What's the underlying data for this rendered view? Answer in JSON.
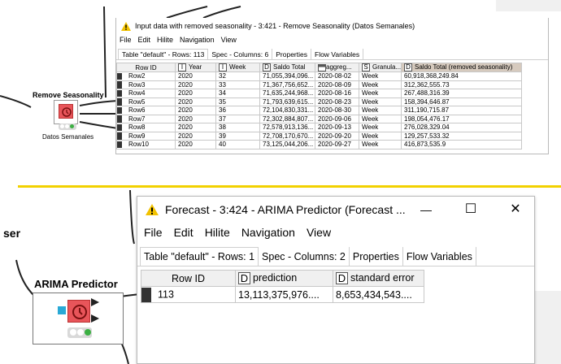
{
  "top": {
    "node": {
      "title": "Remove Seasonality",
      "label": "Datos Semanales"
    },
    "window": {
      "title": "Input data with removed seasonality - 3:421 - Remove Seasonality (Datos Semanales)",
      "menu": [
        "File",
        "Edit",
        "Hilite",
        "Navigation",
        "View"
      ],
      "tabs": [
        "Table \"default\" - Rows: 113",
        "Spec - Columns: 6",
        "Properties",
        "Flow Variables"
      ],
      "columns": [
        {
          "type": "",
          "name": "Row ID"
        },
        {
          "type": "I",
          "name": "Year"
        },
        {
          "type": "I",
          "name": "Week"
        },
        {
          "type": "D",
          "name": "Saldo Total"
        },
        {
          "type": "cal-icon",
          "name": "aggreg..."
        },
        {
          "type": "S",
          "name": "Granula..."
        },
        {
          "type": "D",
          "name": "Saldo Total (removed seasonality)"
        }
      ],
      "rows": [
        [
          "Row2",
          "2020",
          "32",
          "71,055,394,096...",
          "2020-08-02",
          "Week",
          "60,918,368,249.84"
        ],
        [
          "Row3",
          "2020",
          "33",
          "71,367,756,652...",
          "2020-08-09",
          "Week",
          "312,362,555.73"
        ],
        [
          "Row4",
          "2020",
          "34",
          "71,635,244,968...",
          "2020-08-16",
          "Week",
          "267,488,316.39"
        ],
        [
          "Row5",
          "2020",
          "35",
          "71,793,639,615...",
          "2020-08-23",
          "Week",
          "158,394,646.87"
        ],
        [
          "Row6",
          "2020",
          "36",
          "72,104,830,331...",
          "2020-08-30",
          "Week",
          "311,190,715.87"
        ],
        [
          "Row7",
          "2020",
          "37",
          "72,302,884,807...",
          "2020-09-06",
          "Week",
          "198,054,476.17"
        ],
        [
          "Row8",
          "2020",
          "38",
          "72,578,913,136...",
          "2020-09-13",
          "Week",
          "276,028,329.04"
        ],
        [
          "Row9",
          "2020",
          "39",
          "72,708,170,670...",
          "2020-09-20",
          "Week",
          "129,257,533.32"
        ],
        [
          "Row10",
          "2020",
          "40",
          "73,125,044,206...",
          "2020-09-27",
          "Week",
          "416,873,535.9"
        ]
      ]
    }
  },
  "bottom": {
    "side_text": "ser",
    "node": {
      "title": "ARIMA Predictor"
    },
    "window": {
      "title": "Forecast - 3:424 - ARIMA Predictor (Forecast ...",
      "minimize": "—",
      "maximize": "☐",
      "close": "✕",
      "menu": [
        "File",
        "Edit",
        "Hilite",
        "Navigation",
        "View"
      ],
      "tabs": [
        "Table \"default\" - Rows: 1",
        "Spec - Columns: 2",
        "Properties",
        "Flow Variables"
      ],
      "columns": [
        {
          "type": "",
          "name": "Row ID"
        },
        {
          "type": "D",
          "name": "prediction"
        },
        {
          "type": "D",
          "name": "standard error"
        }
      ],
      "rows": [
        [
          "113",
          "13,113,375,976....",
          "8,653,434,543...."
        ]
      ]
    }
  },
  "colors": {
    "divider": "#f2d100",
    "node_red": "#e8555a",
    "port_blue": "#29a9d6"
  }
}
